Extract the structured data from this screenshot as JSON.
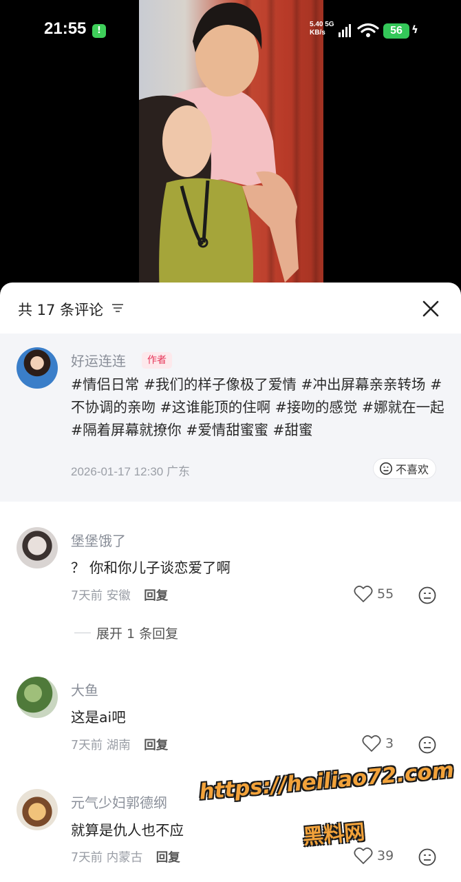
{
  "status_bar": {
    "time": "21:55",
    "charge_symbol": "!",
    "net_speed_value": "5.40",
    "net_speed_unit": "KB/s",
    "network": "5G",
    "battery": "56"
  },
  "header": {
    "title": "共 17 条评论",
    "sort_icon": "filter-lines-icon",
    "close_icon": "close-icon"
  },
  "author_post": {
    "username": "好运连连",
    "badge": "作者",
    "content": "#情侣日常 #我们的样子像极了爱情 #冲出屏幕亲亲转场 #不协调的亲吻 #这谁能顶的住啊 #接吻的感觉 #娜就在一起 #隔着屏幕就撩你 #爱情甜蜜蜜 #甜蜜",
    "time": "2026-01-17 12:30",
    "location": "广东",
    "dislike_label": "不喜欢"
  },
  "comments": [
    {
      "username": "堡堡饿了",
      "text": "？ 你和你儿子谈恋爱了啊",
      "time": "7天前",
      "location": "安徽",
      "reply_label": "回复",
      "likes": "55",
      "expand_label": "展开 1 条回复"
    },
    {
      "username": "大鱼",
      "text": "这是ai吧",
      "time": "7天前",
      "location": "湖南",
      "reply_label": "回复",
      "likes": "3"
    },
    {
      "username": "元气少妇郭德纲",
      "text": "就算是仇人也不应",
      "time": "7天前",
      "location": "内蒙古",
      "reply_label": "回复",
      "likes": "39"
    }
  ],
  "watermark": {
    "url": "https://heiliao72.com",
    "site": "黑料网"
  },
  "colors": {
    "accent_badge": "#e6375a",
    "meta_gray": "#9a9ea6",
    "author_card_bg": "#f4f5f8",
    "watermark": "#f2a23a"
  }
}
